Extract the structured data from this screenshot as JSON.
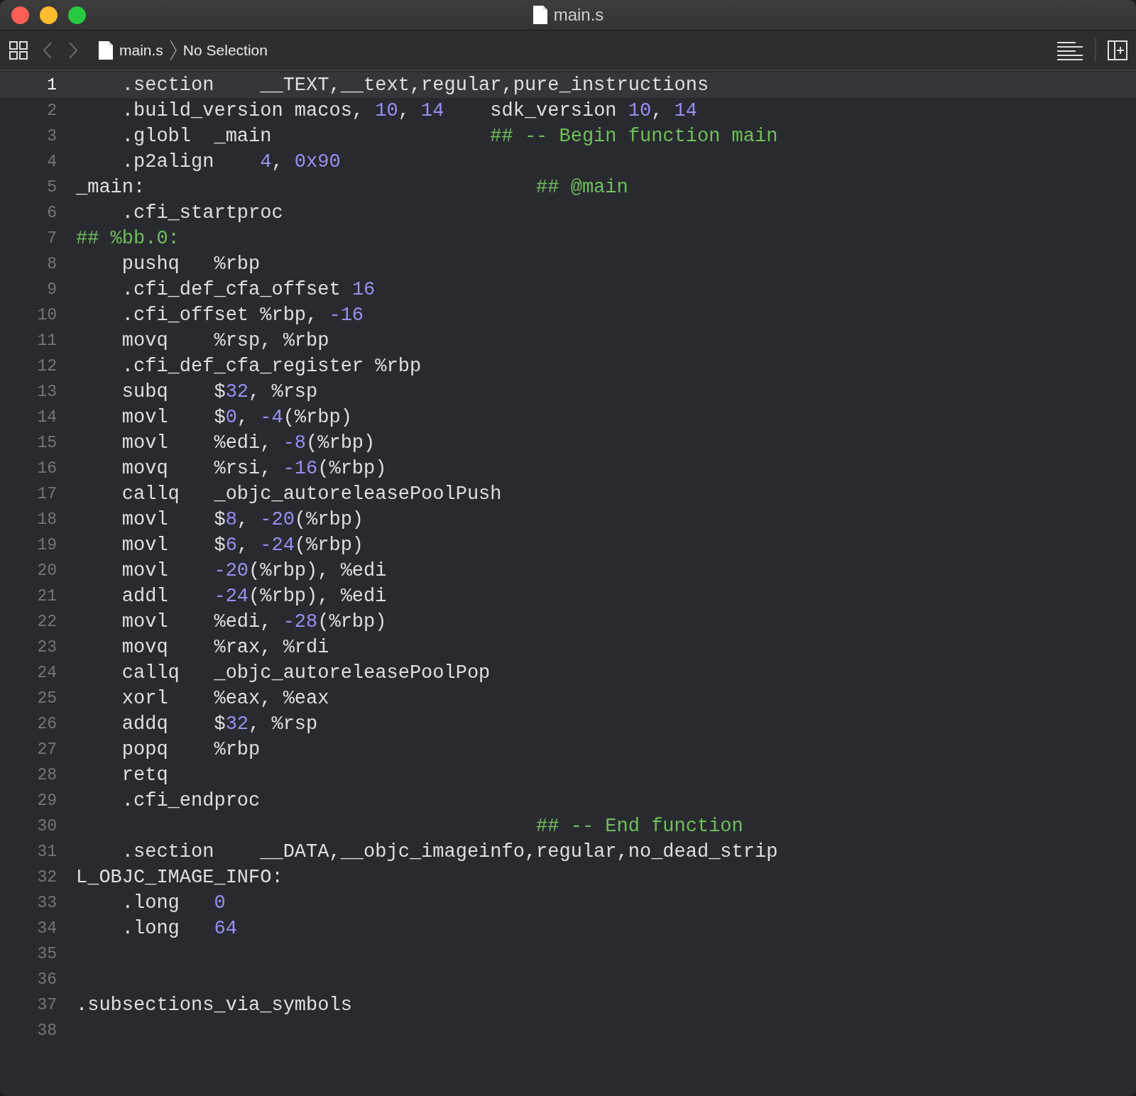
{
  "window": {
    "title": "main.s"
  },
  "jump_bar": {
    "file": "main.s",
    "selection": "No Selection"
  },
  "editor": {
    "lines": [
      {
        "number": "1",
        "current": true,
        "tokens": [
          {
            "kind": "plain",
            "text": "    .section    __TEXT,__text,regular,pure_instructions"
          }
        ]
      },
      {
        "number": "2",
        "current": false,
        "tokens": [
          {
            "kind": "plain",
            "text": "    .build_version macos, "
          },
          {
            "kind": "number",
            "text": "10"
          },
          {
            "kind": "plain",
            "text": ", "
          },
          {
            "kind": "number",
            "text": "14"
          },
          {
            "kind": "plain",
            "text": "    sdk_version "
          },
          {
            "kind": "number",
            "text": "10"
          },
          {
            "kind": "plain",
            "text": ", "
          },
          {
            "kind": "number",
            "text": "14"
          }
        ]
      },
      {
        "number": "3",
        "current": false,
        "tokens": [
          {
            "kind": "plain",
            "text": "    .globl  _main                   "
          },
          {
            "kind": "comment",
            "text": "## -- Begin function main"
          }
        ]
      },
      {
        "number": "4",
        "current": false,
        "tokens": [
          {
            "kind": "plain",
            "text": "    .p2align    "
          },
          {
            "kind": "number",
            "text": "4"
          },
          {
            "kind": "plain",
            "text": ", "
          },
          {
            "kind": "number",
            "text": "0x90"
          }
        ]
      },
      {
        "number": "5",
        "current": false,
        "tokens": [
          {
            "kind": "plain",
            "text": "_main:                                  "
          },
          {
            "kind": "comment",
            "text": "## @main"
          }
        ]
      },
      {
        "number": "6",
        "current": false,
        "tokens": [
          {
            "kind": "plain",
            "text": "    .cfi_startproc"
          }
        ]
      },
      {
        "number": "7",
        "current": false,
        "tokens": [
          {
            "kind": "comment",
            "text": "## %bb.0:"
          }
        ]
      },
      {
        "number": "8",
        "current": false,
        "tokens": [
          {
            "kind": "plain",
            "text": "    pushq   %rbp"
          }
        ]
      },
      {
        "number": "9",
        "current": false,
        "tokens": [
          {
            "kind": "plain",
            "text": "    .cfi_def_cfa_offset "
          },
          {
            "kind": "number",
            "text": "16"
          }
        ]
      },
      {
        "number": "10",
        "current": false,
        "tokens": [
          {
            "kind": "plain",
            "text": "    .cfi_offset %rbp, "
          },
          {
            "kind": "number",
            "text": "-16"
          }
        ]
      },
      {
        "number": "11",
        "current": false,
        "tokens": [
          {
            "kind": "plain",
            "text": "    movq    %rsp, %rbp"
          }
        ]
      },
      {
        "number": "12",
        "current": false,
        "tokens": [
          {
            "kind": "plain",
            "text": "    .cfi_def_cfa_register %rbp"
          }
        ]
      },
      {
        "number": "13",
        "current": false,
        "tokens": [
          {
            "kind": "plain",
            "text": "    subq    $"
          },
          {
            "kind": "number",
            "text": "32"
          },
          {
            "kind": "plain",
            "text": ", %rsp"
          }
        ]
      },
      {
        "number": "14",
        "current": false,
        "tokens": [
          {
            "kind": "plain",
            "text": "    movl    $"
          },
          {
            "kind": "number",
            "text": "0"
          },
          {
            "kind": "plain",
            "text": ", "
          },
          {
            "kind": "number",
            "text": "-4"
          },
          {
            "kind": "plain",
            "text": "(%rbp)"
          }
        ]
      },
      {
        "number": "15",
        "current": false,
        "tokens": [
          {
            "kind": "plain",
            "text": "    movl    %edi, "
          },
          {
            "kind": "number",
            "text": "-8"
          },
          {
            "kind": "plain",
            "text": "(%rbp)"
          }
        ]
      },
      {
        "number": "16",
        "current": false,
        "tokens": [
          {
            "kind": "plain",
            "text": "    movq    %rsi, "
          },
          {
            "kind": "number",
            "text": "-16"
          },
          {
            "kind": "plain",
            "text": "(%rbp)"
          }
        ]
      },
      {
        "number": "17",
        "current": false,
        "tokens": [
          {
            "kind": "plain",
            "text": "    callq   _objc_autoreleasePoolPush"
          }
        ]
      },
      {
        "number": "18",
        "current": false,
        "tokens": [
          {
            "kind": "plain",
            "text": "    movl    $"
          },
          {
            "kind": "number",
            "text": "8"
          },
          {
            "kind": "plain",
            "text": ", "
          },
          {
            "kind": "number",
            "text": "-20"
          },
          {
            "kind": "plain",
            "text": "(%rbp)"
          }
        ]
      },
      {
        "number": "19",
        "current": false,
        "tokens": [
          {
            "kind": "plain",
            "text": "    movl    $"
          },
          {
            "kind": "number",
            "text": "6"
          },
          {
            "kind": "plain",
            "text": ", "
          },
          {
            "kind": "number",
            "text": "-24"
          },
          {
            "kind": "plain",
            "text": "(%rbp)"
          }
        ]
      },
      {
        "number": "20",
        "current": false,
        "tokens": [
          {
            "kind": "plain",
            "text": "    movl    "
          },
          {
            "kind": "number",
            "text": "-20"
          },
          {
            "kind": "plain",
            "text": "(%rbp), %edi"
          }
        ]
      },
      {
        "number": "21",
        "current": false,
        "tokens": [
          {
            "kind": "plain",
            "text": "    addl    "
          },
          {
            "kind": "number",
            "text": "-24"
          },
          {
            "kind": "plain",
            "text": "(%rbp), %edi"
          }
        ]
      },
      {
        "number": "22",
        "current": false,
        "tokens": [
          {
            "kind": "plain",
            "text": "    movl    %edi, "
          },
          {
            "kind": "number",
            "text": "-28"
          },
          {
            "kind": "plain",
            "text": "(%rbp)"
          }
        ]
      },
      {
        "number": "23",
        "current": false,
        "tokens": [
          {
            "kind": "plain",
            "text": "    movq    %rax, %rdi"
          }
        ]
      },
      {
        "number": "24",
        "current": false,
        "tokens": [
          {
            "kind": "plain",
            "text": "    callq   _objc_autoreleasePoolPop"
          }
        ]
      },
      {
        "number": "25",
        "current": false,
        "tokens": [
          {
            "kind": "plain",
            "text": "    xorl    %eax, %eax"
          }
        ]
      },
      {
        "number": "26",
        "current": false,
        "tokens": [
          {
            "kind": "plain",
            "text": "    addq    $"
          },
          {
            "kind": "number",
            "text": "32"
          },
          {
            "kind": "plain",
            "text": ", %rsp"
          }
        ]
      },
      {
        "number": "27",
        "current": false,
        "tokens": [
          {
            "kind": "plain",
            "text": "    popq    %rbp"
          }
        ]
      },
      {
        "number": "28",
        "current": false,
        "tokens": [
          {
            "kind": "plain",
            "text": "    retq"
          }
        ]
      },
      {
        "number": "29",
        "current": false,
        "tokens": [
          {
            "kind": "plain",
            "text": "    .cfi_endproc"
          }
        ]
      },
      {
        "number": "30",
        "current": false,
        "tokens": [
          {
            "kind": "comment",
            "text": "                                        ## -- End function"
          }
        ]
      },
      {
        "number": "31",
        "current": false,
        "tokens": [
          {
            "kind": "plain",
            "text": "    .section    __DATA,__objc_imageinfo,regular,no_dead_strip"
          }
        ]
      },
      {
        "number": "32",
        "current": false,
        "tokens": [
          {
            "kind": "plain",
            "text": "L_OBJC_IMAGE_INFO:"
          }
        ]
      },
      {
        "number": "33",
        "current": false,
        "tokens": [
          {
            "kind": "plain",
            "text": "    .long   "
          },
          {
            "kind": "number",
            "text": "0"
          }
        ]
      },
      {
        "number": "34",
        "current": false,
        "tokens": [
          {
            "kind": "plain",
            "text": "    .long   "
          },
          {
            "kind": "number",
            "text": "64"
          }
        ]
      },
      {
        "number": "35",
        "current": false
      },
      {
        "number": "36",
        "current": false
      },
      {
        "number": "37",
        "current": false,
        "tokens": [
          {
            "kind": "plain",
            "text": ".subsections_via_symbols"
          }
        ]
      },
      {
        "number": "38",
        "current": false
      }
    ]
  }
}
